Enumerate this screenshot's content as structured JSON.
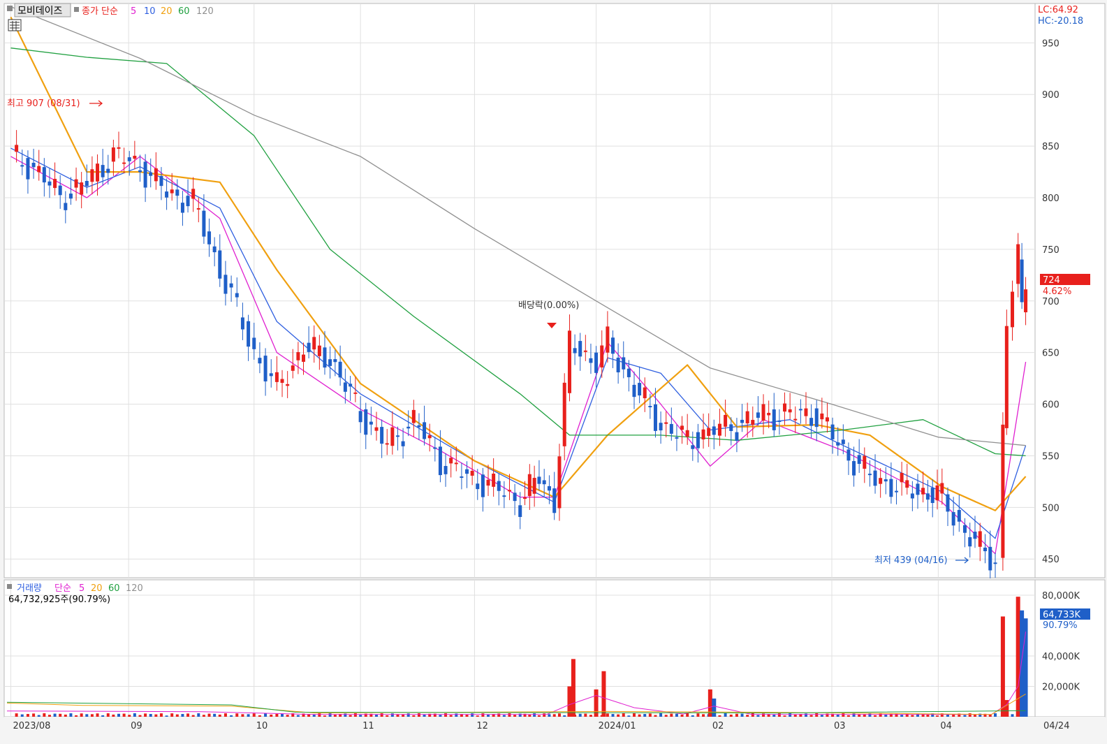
{
  "header": {
    "stock_name": "모비데이즈",
    "price_label": "종가 단순",
    "ma_periods": [
      "5",
      "10",
      "20",
      "60",
      "120"
    ],
    "lc": "LC:64.92",
    "hc": "HC:-20.18"
  },
  "volume_header": {
    "label": "거래량",
    "ma_label": "단순",
    "ma_periods": [
      "5",
      "20",
      "60",
      "120"
    ],
    "value_text": "64,732,925주(90.79%)"
  },
  "annotations": {
    "high": "최고 907 (08/31)",
    "low": "최저 439 (04/16)",
    "dividend": "배당락(0.00%)"
  },
  "price_box": {
    "value": "724",
    "change": "4.62%"
  },
  "volume_box": {
    "value": "64,733K",
    "change": "90.79%"
  },
  "colors": {
    "up": "#e8201c",
    "down": "#1f5fc8",
    "ma5": "#e020d0",
    "ma10": "#3060e0",
    "ma20": "#f0a010",
    "ma60": "#20a040",
    "ma120": "#909090"
  },
  "chart_data": [
    {
      "type": "candlestick",
      "title": "모비데이즈",
      "ylim": [
        440,
        980
      ],
      "y_ticks": [
        450,
        500,
        550,
        600,
        650,
        700,
        750,
        800,
        850,
        900,
        950
      ],
      "x_labels": [
        "2023/08",
        "09",
        "10",
        "11",
        "12",
        "2024/01",
        "02",
        "03",
        "04",
        "04/24"
      ],
      "x_label_dates": [
        "2023-08-01",
        "2023-09-01",
        "2023-10-04",
        "2023-11-01",
        "2023-12-01",
        "2024-01-02",
        "2024-02-01",
        "2024-03-04",
        "2024-04-01",
        "2024-04-24"
      ],
      "close_points": [
        [
          "2023-08-01",
          840
        ],
        [
          "2023-08-07",
          830
        ],
        [
          "2023-08-14",
          800
        ],
        [
          "2023-08-21",
          815
        ],
        [
          "2023-08-28",
          842
        ],
        [
          "2023-09-04",
          830
        ],
        [
          "2023-09-11",
          805
        ],
        [
          "2023-09-18",
          795
        ],
        [
          "2023-09-25",
          730
        ],
        [
          "2023-10-04",
          650
        ],
        [
          "2023-10-10",
          615
        ],
        [
          "2023-10-17",
          655
        ],
        [
          "2023-10-24",
          645
        ],
        [
          "2023-11-01",
          590
        ],
        [
          "2023-11-08",
          560
        ],
        [
          "2023-11-15",
          585
        ],
        [
          "2023-11-22",
          545
        ],
        [
          "2023-11-29",
          530
        ],
        [
          "2023-12-06",
          520
        ],
        [
          "2023-12-13",
          505
        ],
        [
          "2023-12-18",
          530
        ],
        [
          "2023-12-22",
          505
        ],
        [
          "2023-12-26",
          660
        ],
        [
          "2024-01-02",
          640
        ],
        [
          "2024-01-05",
          660
        ],
        [
          "2024-01-12",
          615
        ],
        [
          "2024-01-19",
          580
        ],
        [
          "2024-01-26",
          565
        ],
        [
          "2024-02-02",
          575
        ],
        [
          "2024-02-08",
          580
        ],
        [
          "2024-02-15",
          590
        ],
        [
          "2024-02-22",
          590
        ],
        [
          "2024-02-29",
          590
        ],
        [
          "2024-03-07",
          555
        ],
        [
          "2024-03-14",
          530
        ],
        [
          "2024-03-21",
          520
        ],
        [
          "2024-03-28",
          515
        ],
        [
          "2024-04-02",
          510
        ],
        [
          "2024-04-08",
          475
        ],
        [
          "2024-04-16",
          448
        ],
        [
          "2024-04-18",
          575
        ],
        [
          "2024-04-19",
          680
        ],
        [
          "2024-04-22",
          742
        ],
        [
          "2024-04-23",
          692
        ],
        [
          "2024-04-24",
          724
        ]
      ],
      "ma_series": [
        {
          "name": "5",
          "points": [
            [
              "2023-08-01",
              840
            ],
            [
              "2023-08-21",
              800
            ],
            [
              "2023-09-04",
              840
            ],
            [
              "2023-09-25",
              780
            ],
            [
              "2023-10-10",
              650
            ],
            [
              "2023-11-01",
              595
            ],
            [
              "2023-11-22",
              555
            ],
            [
              "2023-12-13",
              510
            ],
            [
              "2023-12-22",
              510
            ],
            [
              "2024-01-05",
              660
            ],
            [
              "2024-01-19",
              600
            ],
            [
              "2024-02-01",
              540
            ],
            [
              "2024-02-15",
              585
            ],
            [
              "2024-03-07",
              555
            ],
            [
              "2024-04-02",
              505
            ],
            [
              "2024-04-16",
              455
            ],
            [
              "2024-04-24",
              641
            ]
          ]
        },
        {
          "name": "10",
          "points": [
            [
              "2023-08-01",
              848
            ],
            [
              "2023-08-21",
              810
            ],
            [
              "2023-09-04",
              830
            ],
            [
              "2023-09-25",
              790
            ],
            [
              "2023-10-10",
              680
            ],
            [
              "2023-11-01",
              610
            ],
            [
              "2023-12-01",
              545
            ],
            [
              "2023-12-22",
              505
            ],
            [
              "2024-01-05",
              645
            ],
            [
              "2024-01-19",
              630
            ],
            [
              "2024-02-01",
              575
            ],
            [
              "2024-02-22",
              585
            ],
            [
              "2024-03-07",
              560
            ],
            [
              "2024-04-02",
              515
            ],
            [
              "2024-04-16",
              470
            ],
            [
              "2024-04-24",
              560
            ]
          ]
        },
        {
          "name": "20",
          "points": [
            [
              "2023-08-01",
              975
            ],
            [
              "2023-08-21",
              825
            ],
            [
              "2023-09-04",
              825
            ],
            [
              "2023-09-25",
              815
            ],
            [
              "2023-10-10",
              730
            ],
            [
              "2023-11-01",
              620
            ],
            [
              "2023-12-01",
              545
            ],
            [
              "2023-12-22",
              510
            ],
            [
              "2024-01-05",
              570
            ],
            [
              "2024-01-26",
              638
            ],
            [
              "2024-02-08",
              578
            ],
            [
              "2024-02-29",
              580
            ],
            [
              "2024-03-14",
              570
            ],
            [
              "2024-04-02",
              520
            ],
            [
              "2024-04-16",
              497
            ],
            [
              "2024-04-24",
              530
            ]
          ]
        },
        {
          "name": "60",
          "points": [
            [
              "2023-08-01",
              945
            ],
            [
              "2023-08-21",
              936
            ],
            [
              "2023-09-11",
              930
            ],
            [
              "2023-10-04",
              860
            ],
            [
              "2023-10-24",
              750
            ],
            [
              "2023-11-15",
              685
            ],
            [
              "2023-12-13",
              610
            ],
            [
              "2023-12-26",
              570
            ],
            [
              "2024-01-19",
              570
            ],
            [
              "2024-02-08",
              565
            ],
            [
              "2024-03-07",
              575
            ],
            [
              "2024-03-28",
              585
            ],
            [
              "2024-04-16",
              552
            ],
            [
              "2024-04-24",
              550
            ]
          ]
        },
        {
          "name": "120",
          "points": [
            [
              "2023-08-01",
              985
            ],
            [
              "2023-09-04",
              935
            ],
            [
              "2023-10-04",
              880
            ],
            [
              "2023-11-01",
              840
            ],
            [
              "2023-12-01",
              770
            ],
            [
              "2024-01-02",
              700
            ],
            [
              "2024-02-01",
              635
            ],
            [
              "2024-03-04",
              600
            ],
            [
              "2024-04-01",
              568
            ],
            [
              "2024-04-24",
              560
            ]
          ]
        }
      ]
    },
    {
      "type": "bar",
      "title": "거래량",
      "y_ticks_label": [
        "20,000K",
        "40,000K",
        "80,000K"
      ],
      "y_ticks": [
        20000,
        40000,
        80000
      ],
      "ylim": [
        0,
        80000
      ],
      "unit": "K",
      "spikes": [
        {
          "date": "2023-12-26",
          "value": 20000,
          "dir": "up"
        },
        {
          "date": "2023-12-27",
          "value": 38000,
          "dir": "up"
        },
        {
          "date": "2024-01-02",
          "value": 18000,
          "dir": "up"
        },
        {
          "date": "2024-01-04",
          "value": 30000,
          "dir": "up"
        },
        {
          "date": "2024-02-01",
          "value": 18000,
          "dir": "up"
        },
        {
          "date": "2024-02-02",
          "value": 12000,
          "dir": "down"
        },
        {
          "date": "2024-04-18",
          "value": 66000,
          "dir": "up"
        },
        {
          "date": "2024-04-19",
          "value": 11000,
          "dir": "up"
        },
        {
          "date": "2024-04-22",
          "value": 79000,
          "dir": "up"
        },
        {
          "date": "2024-04-23",
          "value": 70000,
          "dir": "down"
        },
        {
          "date": "2024-04-24",
          "value": 64733,
          "dir": "down"
        }
      ]
    }
  ]
}
